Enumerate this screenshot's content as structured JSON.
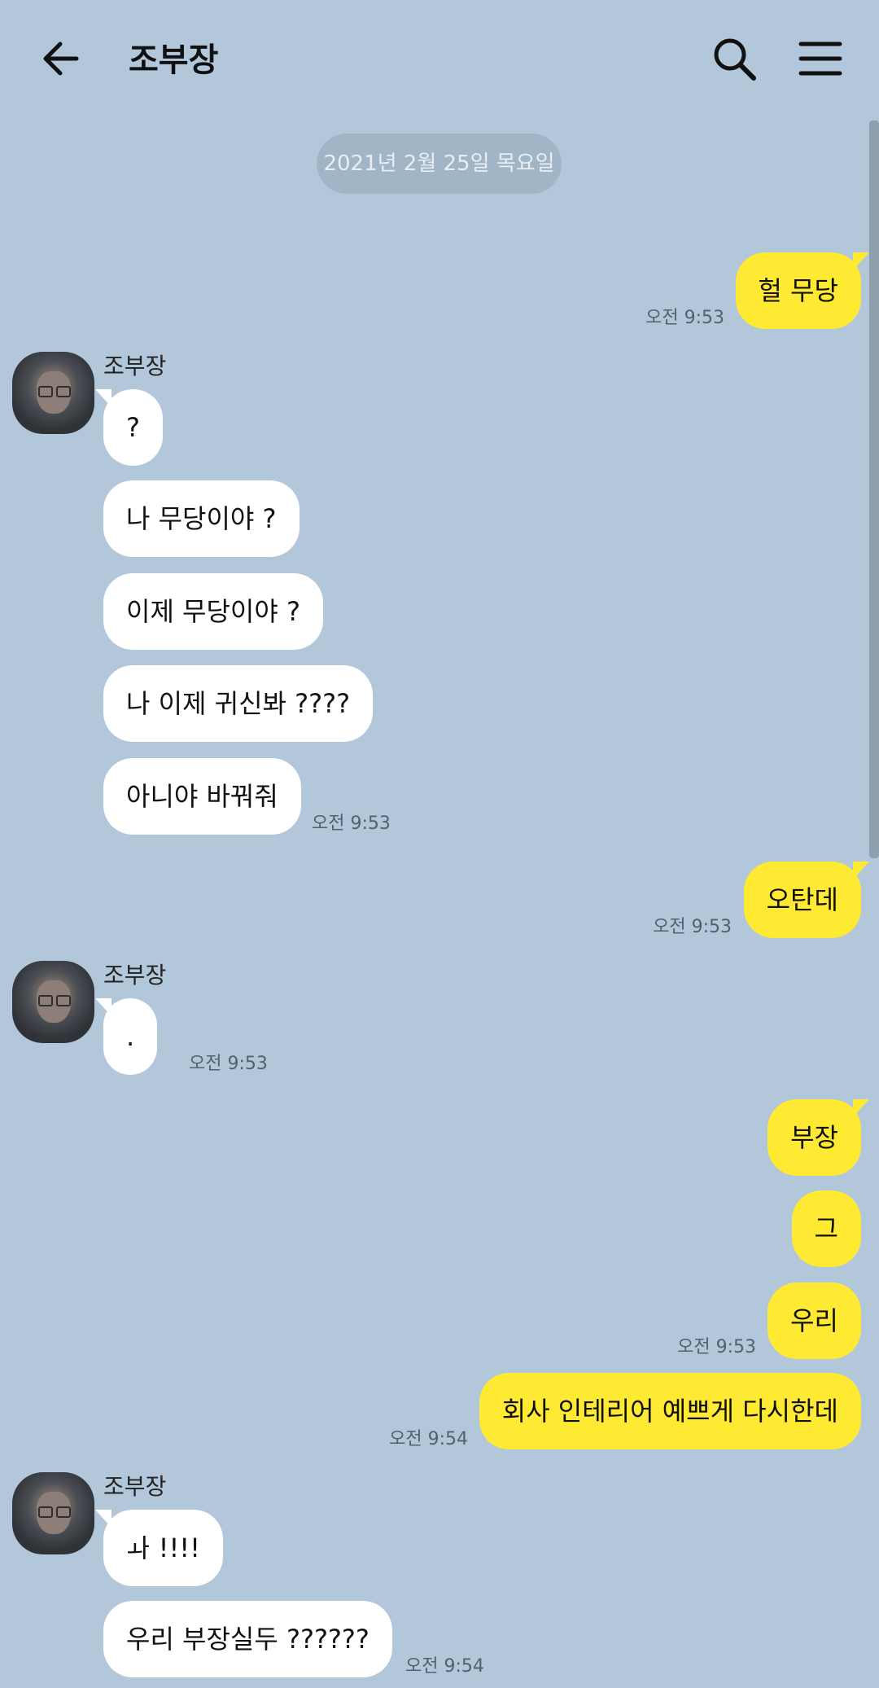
{
  "header": {
    "title": "조부장"
  },
  "date_divider": "2021년 2월 25일 목요일",
  "sender_name": "조부장",
  "messages": {
    "m1": "헐 무당",
    "t1": "오전 9:53",
    "m2": "?",
    "m3": "나 무당이야 ?",
    "m4": "이제 무당이야 ?",
    "m5": "나 이제 귀신봐 ????",
    "m6": "아니야 바꿔줘",
    "t6": "오전 9:53",
    "m7": "오탄데",
    "t7": "오전 9:53",
    "m8": ".",
    "t8": "오전 9:53",
    "m9": "부장",
    "m10": "그",
    "m11": "우리",
    "t11": "오전 9:53",
    "m12": "회사 인테리어 예쁘게 다시한데",
    "t12": "오전 9:54",
    "m13": "ㅘ !!!!",
    "m14": "우리 부장실두 ??????",
    "t14": "오전 9:54"
  },
  "colors": {
    "background": "#b2c7da",
    "outgoing_bubble": "#fee933",
    "incoming_bubble": "#ffffff",
    "date_pill": "#a2b5c6"
  },
  "icons": {
    "back": "arrow-left-icon",
    "search": "magnifier-icon",
    "menu": "hamburger-icon"
  }
}
